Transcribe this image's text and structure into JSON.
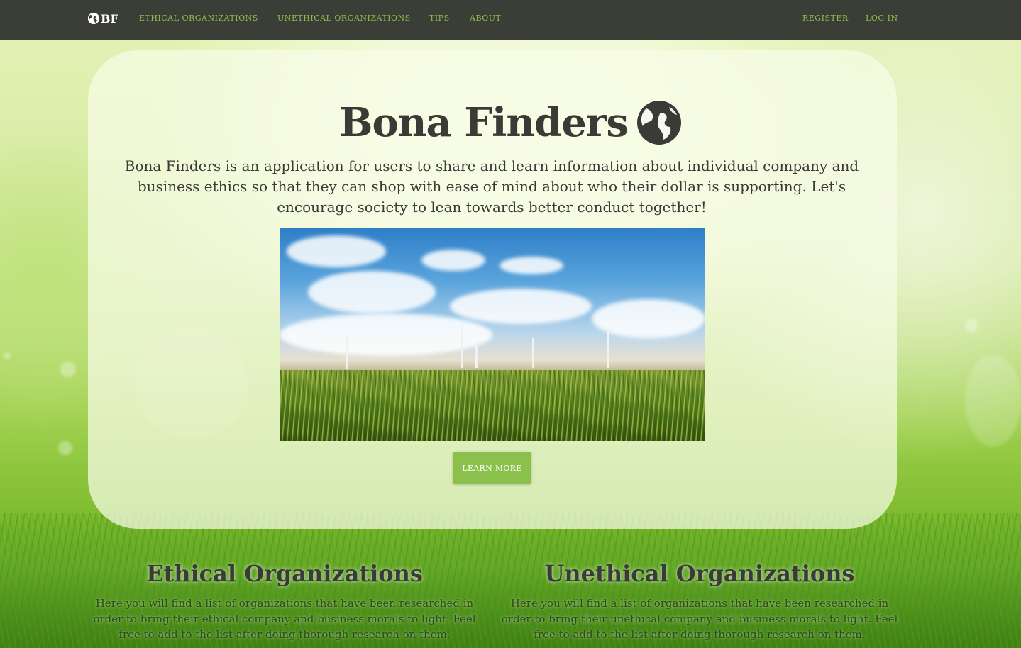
{
  "nav": {
    "brand": "BF",
    "links": [
      "ETHICAL ORGANIZATIONS",
      "UNETHICAL ORGANIZATIONS",
      "TIPS",
      "ABOUT"
    ],
    "register": "REGISTER",
    "login": "LOG IN"
  },
  "hero": {
    "title": "Bona Finders",
    "description": "Bona Finders is an application for users to share and learn information about individual company and business ethics so that they can shop with ease of mind about who their dollar is supporting. Let's encourage society to lean towards better conduct together!",
    "button": "LEARN MORE"
  },
  "sections": [
    {
      "title": "Ethical Organizations",
      "text": "Here you will find a list of organizations that have been researched in order to bring their ethical company and business morals to light. Feel free to add to the list after doing thorough research on them."
    },
    {
      "title": "Unethical Organizations",
      "text": "Here you will find a list of organizations that have been researched in order to bring their unethical company and business morals to light. Feel free to add to the list after doing thorough research on them."
    }
  ],
  "colors": {
    "navbar": "#3b3d37",
    "accent": "#8cc04c",
    "text": "#3a3a36"
  },
  "icons": [
    "globe-icon"
  ]
}
